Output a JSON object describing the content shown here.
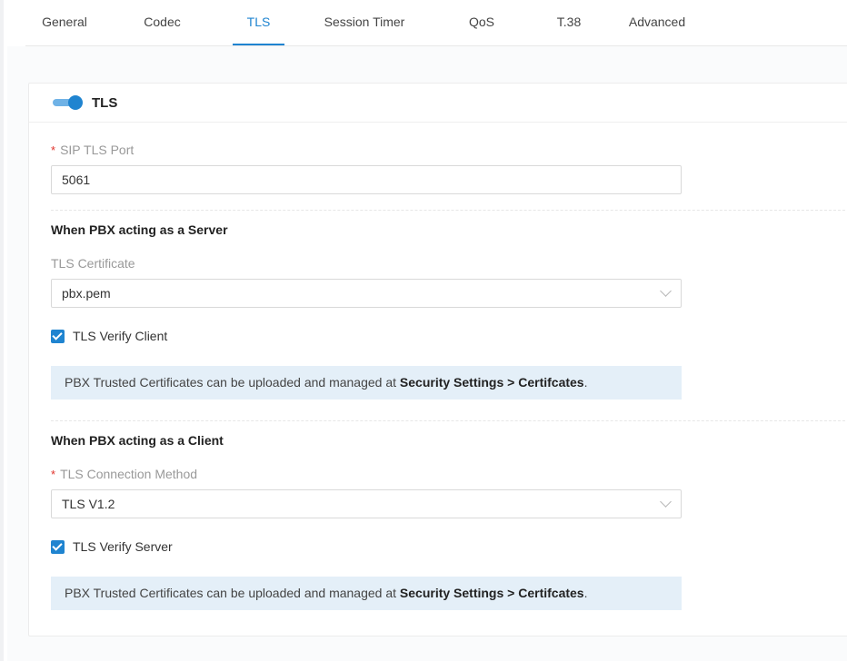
{
  "tabs": [
    {
      "label": "General"
    },
    {
      "label": "Codec"
    },
    {
      "label": "TLS"
    },
    {
      "label": "Session Timer"
    },
    {
      "label": "QoS"
    },
    {
      "label": "T.38"
    },
    {
      "label": "Advanced"
    }
  ],
  "active_tab": "TLS",
  "card": {
    "title": "TLS",
    "toggle_on": true
  },
  "sip_tls_port": {
    "required_mark": "*",
    "label": "SIP TLS Port",
    "value": "5061"
  },
  "server_section": {
    "title": "When PBX acting as a Server",
    "cert_label": "TLS Certificate",
    "cert_value": "pbx.pem",
    "verify_label": "TLS Verify Client",
    "verify_checked": true,
    "notice_prefix": "PBX Trusted Certificates can be uploaded and managed at ",
    "notice_link": "Security Settings > Certifcates",
    "notice_suffix": "."
  },
  "client_section": {
    "title": "When PBX acting as a Client",
    "required_mark": "*",
    "method_label": "TLS Connection Method",
    "method_value": "TLS V1.2",
    "verify_label": "TLS Verify Server",
    "verify_checked": true,
    "notice_prefix": "PBX Trusted Certificates can be uploaded and managed at ",
    "notice_link": "Security Settings > Certifcates",
    "notice_suffix": "."
  },
  "colors": {
    "accent": "#1f84d0",
    "notice_bg": "#e4eff8",
    "required": "#e0322b"
  },
  "icons": {
    "select_arrow": "chevron-down-icon",
    "check": "check-icon"
  }
}
